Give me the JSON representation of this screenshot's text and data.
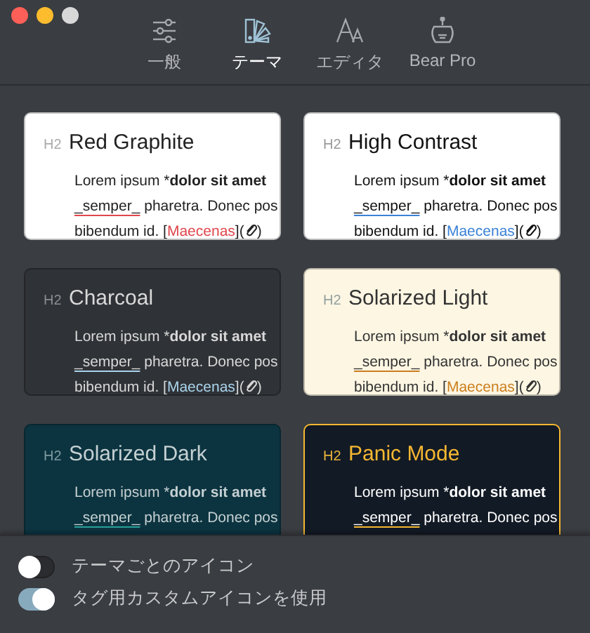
{
  "window": {
    "controls": [
      {
        "kind": "close"
      },
      {
        "kind": "minimize"
      },
      {
        "kind": "zoom"
      }
    ]
  },
  "tabs": [
    {
      "label": "一般",
      "selected": false
    },
    {
      "label": "テーマ",
      "selected": true
    },
    {
      "label": "エディタ",
      "selected": false
    },
    {
      "label": "Bear Pro",
      "selected": false
    }
  ],
  "themes": [
    {
      "heading_mark": "H2",
      "name": "Red Graphite",
      "selected": false,
      "lines": [
        {
          "kind": "emphasis",
          "text": "Lorem ipsum *",
          "bold": "dolor sit amet"
        },
        {
          "kind": "underline",
          "mark": "_semper_",
          "rest": "pharetra. Donec pos"
        },
        {
          "kind": "link",
          "text": "bibendum id. [",
          "link": "Maecenas",
          "after": "](",
          "close": ")"
        }
      ]
    },
    {
      "heading_mark": "H2",
      "name": "High Contrast",
      "selected": false,
      "lines": [
        {
          "kind": "emphasis",
          "text": "Lorem ipsum *",
          "bold": "dolor sit amet"
        },
        {
          "kind": "underline",
          "mark": "_semper_",
          "rest": "pharetra. Donec pos"
        },
        {
          "kind": "link",
          "text": "bibendum id. [",
          "link": "Maecenas",
          "after": "](",
          "close": ")"
        }
      ]
    },
    {
      "heading_mark": "H2",
      "name": "Charcoal",
      "selected": false,
      "lines": [
        {
          "kind": "emphasis",
          "text": "Lorem ipsum *",
          "bold": "dolor sit amet"
        },
        {
          "kind": "underline",
          "mark": "_semper_",
          "rest": "pharetra. Donec pos"
        },
        {
          "kind": "link",
          "text": "bibendum id. [",
          "link": "Maecenas",
          "after": "](",
          "close": ")"
        }
      ]
    },
    {
      "heading_mark": "H2",
      "name": "Solarized Light",
      "selected": false,
      "lines": [
        {
          "kind": "emphasis",
          "text": "Lorem ipsum *",
          "bold": "dolor sit amet"
        },
        {
          "kind": "underline",
          "mark": "_semper_",
          "rest": "pharetra. Donec pos"
        },
        {
          "kind": "link",
          "text": "bibendum id. [",
          "link": "Maecenas",
          "after": "](",
          "close": ")"
        }
      ]
    },
    {
      "heading_mark": "H2",
      "name": "Solarized Dark",
      "selected": false,
      "lines": [
        {
          "kind": "emphasis",
          "text": "Lorem ipsum *",
          "bold": "dolor sit amet"
        },
        {
          "kind": "underline",
          "mark": "_semper_",
          "rest": "pharetra. Donec pos"
        }
      ]
    },
    {
      "heading_mark": "H2",
      "name": "Panic Mode",
      "selected": true,
      "lines": [
        {
          "kind": "emphasis",
          "text": "Lorem ipsum *",
          "bold": "dolor sit amet"
        },
        {
          "kind": "underline",
          "mark": "_semper_",
          "rest": "pharetra. Donec pos"
        }
      ]
    }
  ],
  "options": [
    {
      "label": "テーマごとのアイコン",
      "on": false
    },
    {
      "label": "タグ用カスタムアイコンを使用",
      "on": true
    }
  ]
}
